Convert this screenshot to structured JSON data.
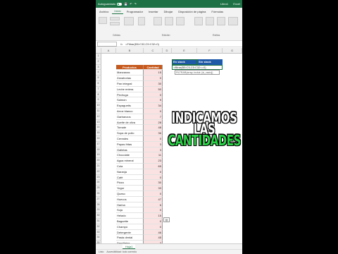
{
  "titlebar": {
    "autosave_label": "Autoguardado",
    "filename": "Libro1",
    "app": "Excel",
    "sheet_label": "Libro1",
    "qat_icons": [
      "save-icon",
      "undo-icon",
      "redo-icon"
    ]
  },
  "tabs": [
    {
      "label": "Archivo"
    },
    {
      "label": "Inicio"
    },
    {
      "label": "Programador"
    },
    {
      "label": "Insertar"
    },
    {
      "label": "Dibujar"
    },
    {
      "label": "Disposición de página"
    },
    {
      "label": "Fórmulas"
    }
  ],
  "ribbon": {
    "groups": [
      {
        "label": "Celdas"
      },
      {
        "label": "Edición"
      },
      {
        "label": "Estilos"
      }
    ]
  },
  "formula_bar": {
    "fx": "fx",
    "text": "=Filtrar(B5:C32;C5:C32=0)"
  },
  "columns": [
    "A",
    "B",
    "C",
    "D",
    "E",
    "F",
    "G"
  ],
  "table": {
    "header_name": "Productos",
    "header_qty": "Cantidad",
    "rows": [
      {
        "n": "4",
        "name": "Manzanas",
        "qty": "15"
      },
      {
        "n": "5",
        "name": "Zanahorias",
        "qty": "0"
      },
      {
        "n": "6",
        "name": "Pan integral",
        "qty": "30"
      },
      {
        "n": "7",
        "name": "Leche entera",
        "qty": "50"
      },
      {
        "n": "8",
        "name": "Pechuga",
        "qty": "0"
      },
      {
        "n": "9",
        "name": "Salmón",
        "qty": "9"
      },
      {
        "n": "10",
        "name": "Espaguetis",
        "qty": "34"
      },
      {
        "n": "11",
        "name": "Arroz blanco",
        "qty": "0"
      },
      {
        "n": "12",
        "name": "Garbanzos",
        "qty": "7"
      },
      {
        "n": "13",
        "name": "Aceite de oliva",
        "qty": "28"
      },
      {
        "n": "14",
        "name": "Tomate",
        "qty": "48"
      },
      {
        "n": "15",
        "name": "Sopa de pollo",
        "qty": "36"
      },
      {
        "n": "16",
        "name": "Cereales",
        "qty": "0"
      },
      {
        "n": "17",
        "name": "Papas fritas",
        "qty": "3"
      },
      {
        "n": "18",
        "name": "Galletas",
        "qty": "3"
      },
      {
        "n": "19",
        "name": "Chocolate",
        "qty": "11"
      },
      {
        "n": "20",
        "name": "Agua mineral",
        "qty": "23"
      },
      {
        "n": "21",
        "name": "Cola",
        "qty": "65"
      },
      {
        "n": "22",
        "name": "Naranja",
        "qty": "0"
      },
      {
        "n": "23",
        "name": "Café",
        "qty": "0"
      },
      {
        "n": "24",
        "name": "Pizza",
        "qty": "30"
      },
      {
        "n": "25",
        "name": "Yogur",
        "qty": "33"
      },
      {
        "n": "26",
        "name": "Queso",
        "qty": "0"
      },
      {
        "n": "27",
        "name": "Huevos",
        "qty": "47"
      },
      {
        "n": "28",
        "name": "Harina",
        "qty": "6"
      },
      {
        "n": "29",
        "name": "Soja",
        "qty": "0"
      },
      {
        "n": "30",
        "name": "Helado",
        "qty": "15"
      },
      {
        "n": "31",
        "name": "Baguette",
        "qty": "0"
      },
      {
        "n": "32",
        "name": "Champú",
        "qty": "0"
      },
      {
        "n": "33",
        "name": "Detergente",
        "qty": "46"
      },
      {
        "n": "34",
        "name": "Pasta dental",
        "qty": "45"
      },
      {
        "n": "35",
        "name": "Servilletas",
        "qty": "3"
      }
    ]
  },
  "extra_rows": [
    {
      "n": "1"
    },
    {
      "n": "2"
    },
    {
      "n": "3"
    }
  ],
  "stock": {
    "in_stock": "En stock",
    "out_stock": "Sin stock",
    "edit_text": "=filtrar(B5:C5,C5:C32<=0)",
    "tooltip": "FILTRAR(array; incluir; [si_vacío])"
  },
  "overlay": {
    "line1": "INDICAMOS",
    "line2": "LAS",
    "line3": "CANTIDADES"
  },
  "paste_icon": "paste-options-icon",
  "sheet_tab": "Hoja1",
  "status": {
    "left": "Listo",
    "accessibility": "Accesibilidad: todo correcto"
  },
  "colors": {
    "excel_green": "#1e7145",
    "header_orange": "#c65a1e",
    "qty_fill": "#fbe2e2",
    "stock_blue": "#1e5aa8",
    "overlay_green": "#2fd14a"
  }
}
